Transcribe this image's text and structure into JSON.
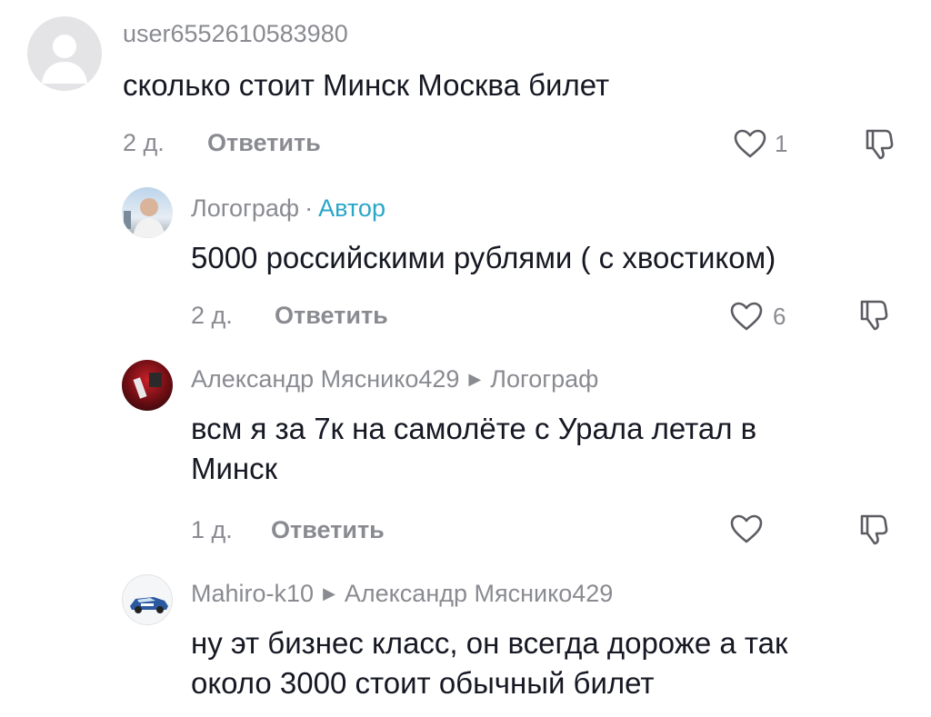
{
  "comments": [
    {
      "username": "user6552610583980",
      "text": "сколько стоит Минск Москва билет",
      "time": "2 д.",
      "reply_label": "Ответить",
      "likes": "1",
      "avatar_icon": "default-avatar-icon"
    },
    {
      "username": "Логограф",
      "separator": "·",
      "badge": "Автор",
      "text": "5000 российскими рублями ( с хвостиком)",
      "time": "2 д.",
      "reply_label": "Ответить",
      "likes": "6",
      "avatar_icon": "user-photo-avatar"
    },
    {
      "username": "Александр Мяснико429",
      "reply_to": "Логограф",
      "text_line1": "всм я за 7к на самолёте с Урала летал в",
      "text_line2": "Минск",
      "time": "1 д.",
      "reply_label": "Ответить",
      "avatar_icon": "user-photo-avatar"
    },
    {
      "username": "Mahiro-k10",
      "reply_to": "Александр Мяснико429",
      "text_line1": "ну эт бизнес класс, он всегда дороже а так",
      "text_line2": "около 3000 стоит обычный билет",
      "avatar_icon": "car-photo-avatar"
    }
  ],
  "colors": {
    "text": "#161823",
    "muted": "#8a8b91",
    "author_badge": "#2aa6c9"
  }
}
